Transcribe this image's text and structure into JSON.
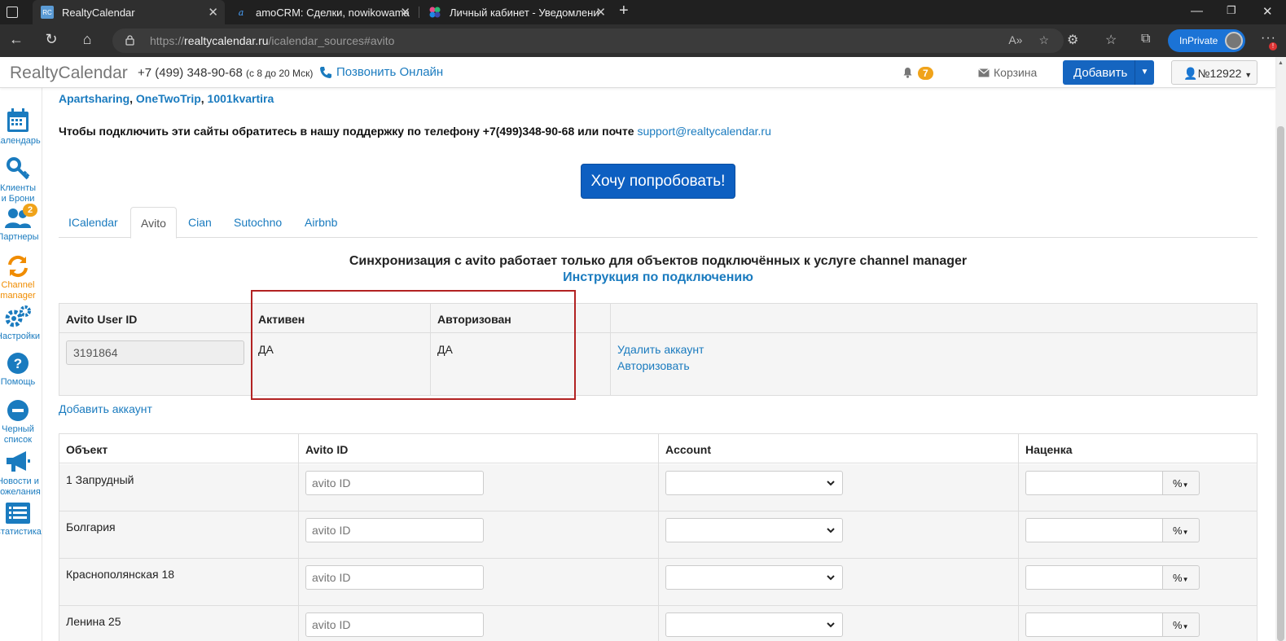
{
  "browser": {
    "tabs": [
      {
        "title": "RealtyCalendar",
        "favicon": "RC",
        "active": true
      },
      {
        "title": "amoCRM: Сделки, nowikowama",
        "favicon": "a",
        "active": false
      },
      {
        "title": "Личный кабинет - Уведомлени",
        "favicon": "dots",
        "active": false
      }
    ],
    "url_prefix": "https://",
    "url_host": "realtycalendar.ru",
    "url_path": "/icalendar_sources#avito",
    "inprivate_label": "InPrivate"
  },
  "header": {
    "brand": "RealtyCalendar",
    "phone": "+7 (499) 348-90-68",
    "phone_hours": "(с 8 до 20 Мск)",
    "call_online": "Позвонить Онлайн",
    "notifications_count": "7",
    "trash_label": "Корзина",
    "add_label": "Добавить",
    "account_label": "№12922"
  },
  "sidebar": {
    "items": [
      {
        "label_1": "Календарь",
        "label_2": ""
      },
      {
        "label_1": "Клиенты",
        "label_2": "и Брони"
      },
      {
        "label_1": "Партнеры",
        "label_2": "",
        "badge": "2"
      },
      {
        "label_1": "Channel",
        "label_2": "manager"
      },
      {
        "label_1": "Настройки",
        "label_2": ""
      },
      {
        "label_1": "Помощь",
        "label_2": ""
      },
      {
        "label_1": "Черный",
        "label_2": "список"
      },
      {
        "label_1": "Новости и",
        "label_2": "пожелания"
      },
      {
        "label_1": "Статистика",
        "label_2": ""
      }
    ]
  },
  "content": {
    "sites": [
      "Apartsharing",
      "OneTwoTrip",
      "1001kvartira"
    ],
    "support_text": "Чтобы подключить эти сайты обратитесь в нашу поддержку по телефону +7(499)348-90-68 или почте",
    "support_email": "support@realtycalendar.ru",
    "try_button": "Хочу попробовать!",
    "tabs": [
      "ICalendar",
      "Avito",
      "Cian",
      "Sutochno",
      "Airbnb"
    ],
    "active_tab": "Avito",
    "sync_title": "Синхронизация с avito работает только для объектов подключённых к услуге channel manager",
    "sync_instruction": "Инструкция по подключению"
  },
  "accounts_table": {
    "headers": [
      "Avito User ID",
      "Активен",
      "Авторизован",
      ""
    ],
    "row": {
      "user_id": "3191864",
      "active": "ДА",
      "authorized": "ДА",
      "delete_link": "Удалить аккаунт",
      "authorize_link": "Авторизовать"
    },
    "add_account": "Добавить аккаунт"
  },
  "objects_table": {
    "headers": [
      "Объект",
      "Avito ID",
      "Account",
      "Наценка"
    ],
    "id_placeholder": "avito ID",
    "markup_unit": "%",
    "rows": [
      {
        "name": "1 Запрудный",
        "avito_id": ""
      },
      {
        "name": "Болгария",
        "avito_id": ""
      },
      {
        "name": "Краснополянская 18",
        "avito_id": ""
      },
      {
        "name": "Ленина 25",
        "avito_id": ""
      }
    ]
  },
  "colors": {
    "link": "#1a7bbf",
    "primary_button": "#1565c0",
    "badge": "#f0a31a",
    "highlight_border": "#b22222",
    "channel_manager": "#f08c00"
  }
}
